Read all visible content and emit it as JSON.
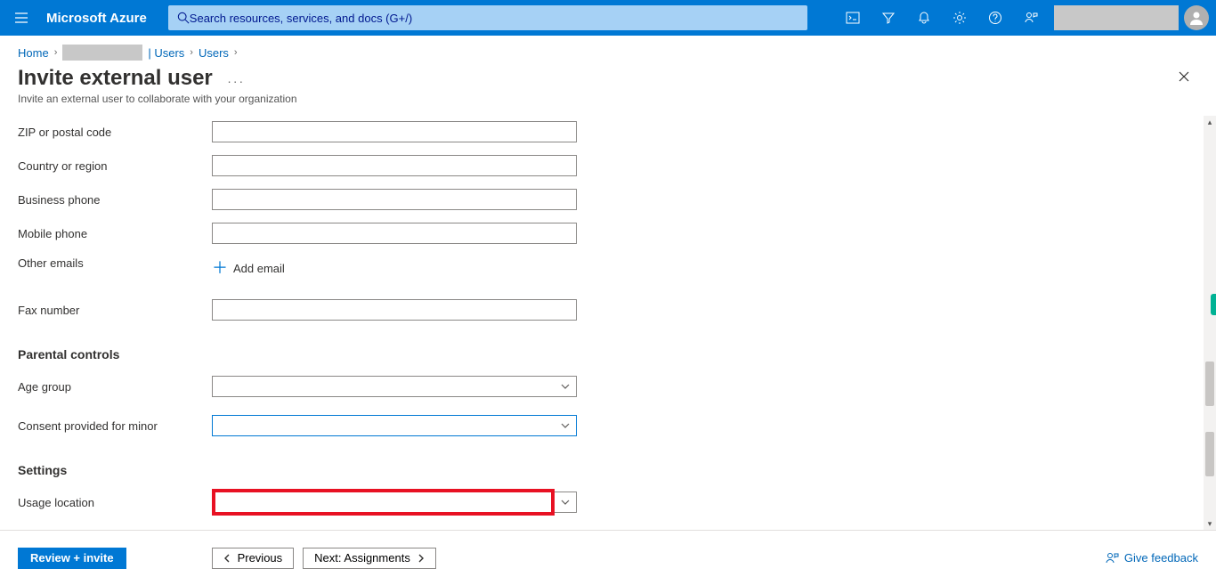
{
  "topbar": {
    "brand": "Microsoft Azure",
    "search_placeholder": "Search resources, services, and docs (G+/)"
  },
  "breadcrumb": {
    "home": "Home",
    "users1": "| Users",
    "users2": "Users"
  },
  "page": {
    "title": "Invite external user",
    "subtitle": "Invite an external user to collaborate with your organization"
  },
  "fields": {
    "zip": {
      "label": "ZIP or postal code",
      "value": ""
    },
    "country": {
      "label": "Country or region",
      "value": ""
    },
    "biz_phone": {
      "label": "Business phone",
      "value": ""
    },
    "mob_phone": {
      "label": "Mobile phone",
      "value": ""
    },
    "other_emails": {
      "label": "Other emails",
      "add_label": "Add email"
    },
    "fax": {
      "label": "Fax number",
      "value": ""
    },
    "parental_heading": "Parental controls",
    "age_group": {
      "label": "Age group",
      "value": ""
    },
    "consent": {
      "label": "Consent provided for minor",
      "value": ""
    },
    "settings_heading": "Settings",
    "usage_location": {
      "label": "Usage location",
      "value": ""
    }
  },
  "footer": {
    "review": "Review + invite",
    "previous": "Previous",
    "next": "Next: Assignments",
    "feedback": "Give feedback"
  }
}
